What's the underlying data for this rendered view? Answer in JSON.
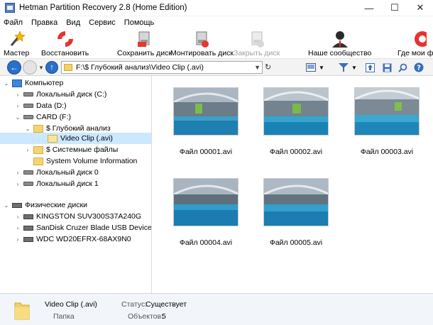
{
  "window": {
    "title": "Hetman Partition Recovery 2.8 (Home Edition)",
    "minimize_glyph": "—",
    "maximize_glyph": "☐",
    "close_glyph": "✕"
  },
  "menu": [
    "Файл",
    "Правка",
    "Вид",
    "Сервис",
    "Помощь"
  ],
  "toolbar": {
    "master": "Мастер",
    "restore": "Восстановить",
    "save_disk": "Сохранить диск",
    "mount_disk": "Монтировать диск",
    "close_disk": "Закрыть диск",
    "community": "Наше сообщество",
    "where_files": "Где мои фа"
  },
  "address": {
    "path": "F:\\$ Глубокий анализ\\Video Clip (.avi)"
  },
  "tree": {
    "computer": "Компьютер",
    "local_c": "Локальный диск (C:)",
    "data_d": "Data (D:)",
    "card_f": "CARD (F:)",
    "deep_analysis": "$ Глубокий анализ",
    "video_clip": "Video Clip (.avi)",
    "system_files": "$ Системные файлы",
    "svi": "System Volume Information",
    "local_0": "Локальный диск 0",
    "local_1": "Локальный диск 1",
    "physical": "Физические диски",
    "kingston": "KINGSTON SUV300S37A240G",
    "sandisk": "SanDisk Cruzer Blade USB Device",
    "wdc": "WDC WD20EFRX-68AX9N0"
  },
  "files": [
    {
      "name": "Файл 00001.avi"
    },
    {
      "name": "Файл 00002.avi"
    },
    {
      "name": "Файл 00003.avi"
    },
    {
      "name": "Файл 00004.avi"
    },
    {
      "name": "Файл 00005.avi"
    }
  ],
  "status": {
    "name": "Video Clip (.avi)",
    "type": "Папка",
    "status_label": "Статус:",
    "status_value": "Существует",
    "objects_label": "Объектов:",
    "objects_value": "5"
  },
  "colors": {
    "selection": "#cce8ff",
    "statusbar": "#f2f6fb",
    "accent": "#2a6fc9"
  }
}
